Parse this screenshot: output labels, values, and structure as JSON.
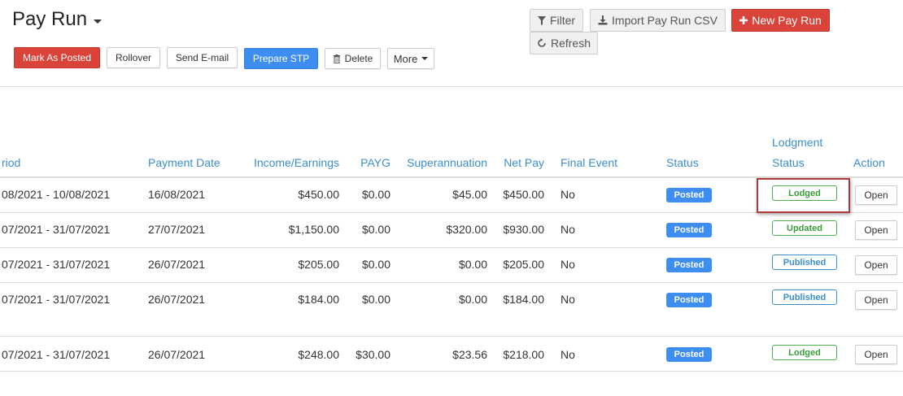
{
  "header": {
    "title": "Pay Run"
  },
  "toolbar": {
    "mark_as_posted": "Mark As Posted",
    "rollover": "Rollover",
    "send_email": "Send E-mail",
    "prepare_stp": "Prepare STP",
    "delete": "Delete",
    "more": "More",
    "filter": "Filter",
    "import_csv": "Import Pay Run CSV",
    "new_pay_run": "New Pay Run",
    "refresh": "Refresh"
  },
  "icons": {
    "filter": "funnel-icon",
    "import": "download-icon",
    "new": "plus-icon",
    "refresh": "refresh-icon",
    "delete": "trash-icon"
  },
  "colors": {
    "danger": "#d9433a",
    "primary": "#3d8ef0",
    "link_header": "#3d8ec9",
    "lodged_green": "#4cae4c",
    "highlight": "#b03a3a"
  },
  "table": {
    "columns": {
      "period": "riod",
      "payment_date": "Payment Date",
      "income": "Income/Earnings",
      "payg": "PAYG",
      "super": "Superannuation",
      "net_pay": "Net Pay",
      "final_event": "Final Event",
      "status": "Status",
      "lodgment_line1": "Lodgment",
      "lodgment_line2": "Status",
      "action": "Action"
    },
    "rows": [
      {
        "period": "08/2021 - 10/08/2021",
        "payment_date": "16/08/2021",
        "income": "$450.00",
        "payg": "$0.00",
        "super": "$45.00",
        "net_pay": "$450.00",
        "final_event": "No",
        "status": "Posted",
        "lodgment": "Lodged",
        "action": "Open"
      },
      {
        "period": "07/2021 - 31/07/2021",
        "payment_date": "27/07/2021",
        "income": "$1,150.00",
        "payg": "$0.00",
        "super": "$320.00",
        "net_pay": "$930.00",
        "final_event": "No",
        "status": "Posted",
        "lodgment": "Updated",
        "action": "Open"
      },
      {
        "period": "07/2021 - 31/07/2021",
        "payment_date": "26/07/2021",
        "income": "$205.00",
        "payg": "$0.00",
        "super": "$0.00",
        "net_pay": "$205.00",
        "final_event": "No",
        "status": "Posted",
        "lodgment": "Published",
        "action": "Open"
      },
      {
        "period": "07/2021 - 31/07/2021",
        "payment_date": "26/07/2021",
        "income": "$184.00",
        "payg": "$0.00",
        "super": "$0.00",
        "net_pay": "$184.00",
        "final_event": "No",
        "status": "Posted",
        "lodgment": "Published",
        "action": "Open"
      },
      {
        "period": "07/2021 - 31/07/2021",
        "payment_date": "26/07/2021",
        "income": "$248.00",
        "payg": "$30.00",
        "super": "$23.56",
        "net_pay": "$218.00",
        "final_event": "No",
        "status": "Posted",
        "lodgment": "Lodged",
        "action": "Open"
      }
    ]
  }
}
